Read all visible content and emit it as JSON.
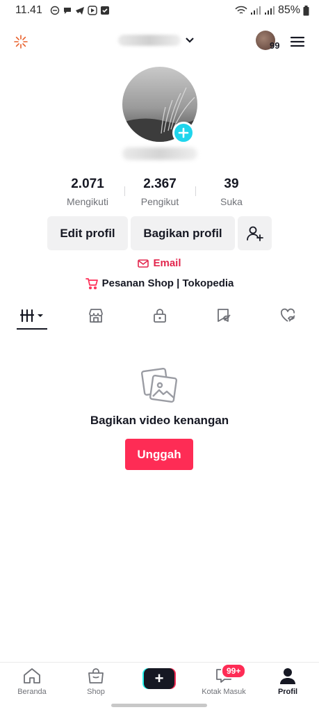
{
  "status_bar": {
    "time": "11.41",
    "battery": "85%"
  },
  "header": {
    "notification_badge": "99"
  },
  "stats": [
    {
      "value": "2.071",
      "label": "Mengikuti"
    },
    {
      "value": "2.367",
      "label": "Pengikut"
    },
    {
      "value": "39",
      "label": "Suka"
    }
  ],
  "actions": {
    "edit_profile": "Edit profil",
    "share_profile": "Bagikan profil"
  },
  "links": {
    "email": "Email",
    "shop": "Pesanan Shop | Tokopedia"
  },
  "empty_state": {
    "title": "Bagikan video kenangan",
    "button": "Unggah"
  },
  "bottom_nav": {
    "home": "Beranda",
    "shop": "Shop",
    "create": "+",
    "inbox": "Kotak Masuk",
    "inbox_badge": "99+",
    "profile": "Profil"
  },
  "colors": {
    "accent": "#fe2c55",
    "link_red": "#e2264d",
    "teal": "#20d5ec"
  }
}
